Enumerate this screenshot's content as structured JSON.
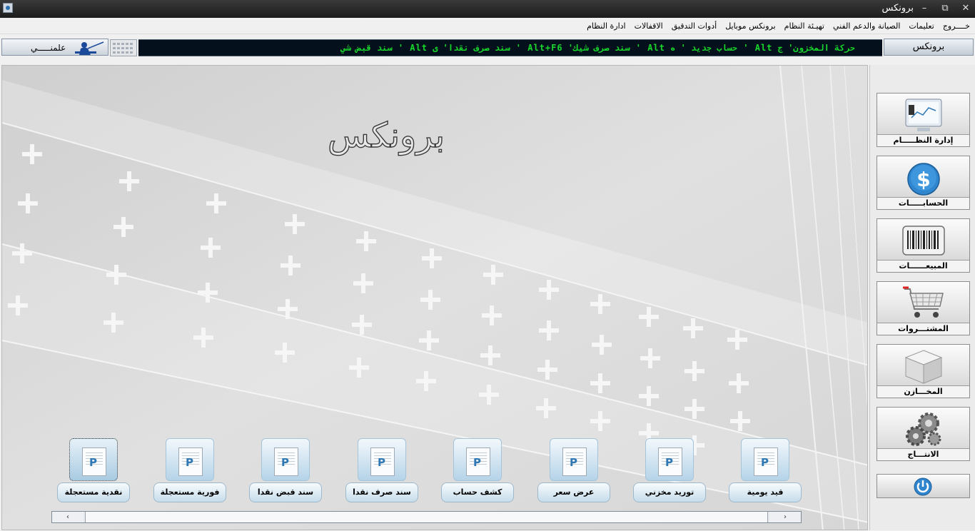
{
  "window": {
    "title": "برونكس",
    "controls": {
      "minimize": "–",
      "restore": "⧉",
      "close": "✕"
    }
  },
  "menu": [
    {
      "label": "ادارة النظام"
    },
    {
      "label": "الاقفالات"
    },
    {
      "label": "أدوات التدقيق"
    },
    {
      "label": "برونكس موبايل"
    },
    {
      "label": "تهيـئة النظام"
    },
    {
      "label": "الصيانة والدعم الفني"
    },
    {
      "label": "تعليمات"
    },
    {
      "label": "خــــروج"
    }
  ],
  "infobar": {
    "brand": "برونكس",
    "ticker": "حركة المخزون' ج Alt '    حساب جديد ' ه Alt '    سند صرف شيك' Alt+F6 '    سند صرف نقدا' ى Alt '    سند قبض شي",
    "user_name": "علمنـــــي"
  },
  "main": {
    "logo": "برونكس",
    "shortcuts": [
      {
        "label": "قيد يومية"
      },
      {
        "label": "توريد مخزني"
      },
      {
        "label": "عرض سعر"
      },
      {
        "label": "كشف حساب"
      },
      {
        "label": "سند صرف نقدا"
      },
      {
        "label": "سند قبض نقدا"
      },
      {
        "label": "فورية مستعجلة"
      },
      {
        "label": "نقدية مستعجلة"
      }
    ],
    "scroll": {
      "left_arrow": "‹",
      "right_arrow": "›"
    }
  },
  "modules": [
    {
      "label": "إدارة النظـــــام",
      "icon": "monitor-icon"
    },
    {
      "label": "الحسابـــــات",
      "icon": "dollar-icon"
    },
    {
      "label": "المبيعــــــات",
      "icon": "barcode-icon"
    },
    {
      "label": "المشتـــروات",
      "icon": "cart-icon"
    },
    {
      "label": "المخـــازن",
      "icon": "box-icon"
    },
    {
      "label": "الانتـــاج",
      "icon": "gears-icon"
    }
  ],
  "colors": {
    "ticker_text": "#18d82c",
    "ticker_bg": "#04101c",
    "accent_blue": "#2d78b5"
  }
}
